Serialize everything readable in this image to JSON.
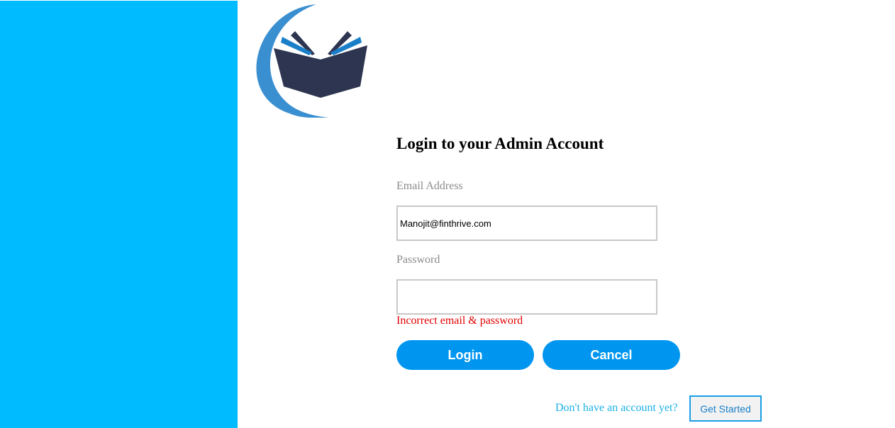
{
  "colors": {
    "side_panel": "#00bbff",
    "button": "#0096f0",
    "error": "#e00000",
    "link_text": "#1ab0e8",
    "logo_arc": "#3a8fd0",
    "logo_book": "#2e3550"
  },
  "logo": {
    "icon": "open-book-logo"
  },
  "form": {
    "title": "Login to your Admin Account",
    "email_label": "Email Address",
    "email_value": "Manojit@finthrive.com",
    "password_label": "Password",
    "password_value": "",
    "error_message": "Incorrect email & password",
    "login_label": "Login",
    "cancel_label": "Cancel"
  },
  "footer": {
    "prompt": "Don't have an account yet?",
    "get_started_label": "Get Started"
  }
}
